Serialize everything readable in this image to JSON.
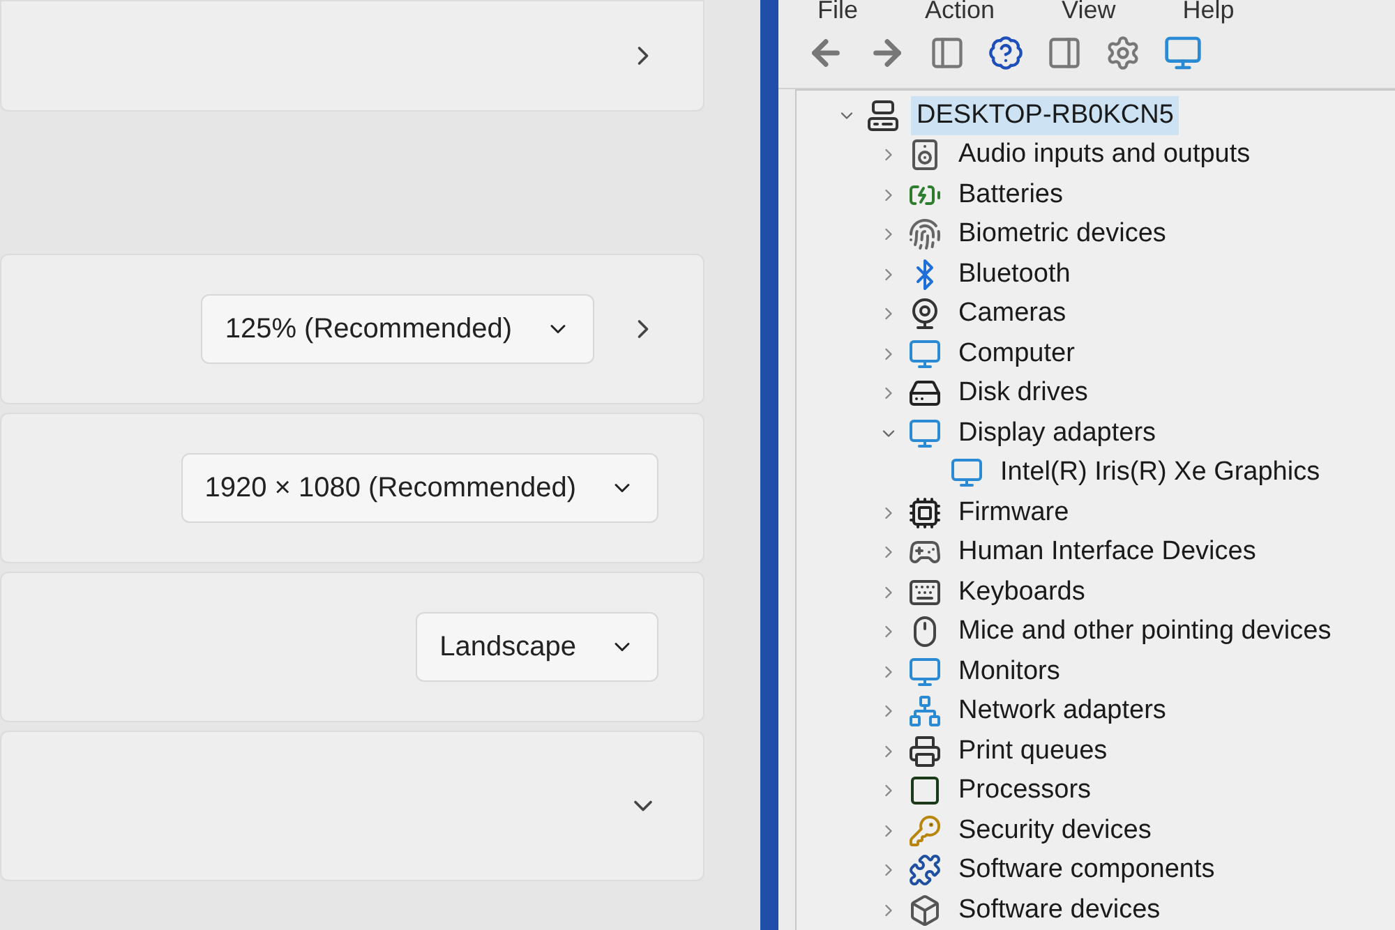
{
  "settings": {
    "cards": [
      {
        "kind": "link"
      },
      {
        "kind": "dropdown_link",
        "dropdown": "125% (Recommended)"
      },
      {
        "kind": "dropdown",
        "dropdown": "1920 × 1080 (Recommended)"
      },
      {
        "kind": "dropdown",
        "dropdown": "Landscape"
      },
      {
        "kind": "expander"
      }
    ]
  },
  "device_manager": {
    "menu": [
      "File",
      "Action",
      "View",
      "Help"
    ],
    "tree": {
      "label": "DESKTOP-RB0KCN5",
      "expanded": true,
      "selected": true,
      "children": [
        {
          "label": "Audio inputs and outputs",
          "expanded": false,
          "selected": false
        },
        {
          "label": "Batteries",
          "expanded": false,
          "selected": false
        },
        {
          "label": "Biometric devices",
          "expanded": false,
          "selected": false
        },
        {
          "label": "Bluetooth",
          "expanded": false,
          "selected": false
        },
        {
          "label": "Cameras",
          "expanded": false,
          "selected": false
        },
        {
          "label": "Computer",
          "expanded": false,
          "selected": false
        },
        {
          "label": "Disk drives",
          "expanded": false,
          "selected": false
        },
        {
          "label": "Display adapters",
          "expanded": true,
          "selected": false,
          "children": [
            {
              "label": "Intel(R) Iris(R) Xe Graphics",
              "selected": false
            }
          ]
        },
        {
          "label": "Firmware",
          "expanded": false,
          "selected": false
        },
        {
          "label": "Human Interface Devices",
          "expanded": false,
          "selected": false
        },
        {
          "label": "Keyboards",
          "expanded": false,
          "selected": false
        },
        {
          "label": "Mice and other pointing devices",
          "expanded": false,
          "selected": false
        },
        {
          "label": "Monitors",
          "expanded": false,
          "selected": false
        },
        {
          "label": "Network adapters",
          "expanded": false,
          "selected": false
        },
        {
          "label": "Print queues",
          "expanded": false,
          "selected": false
        },
        {
          "label": "Processors",
          "expanded": false,
          "selected": false
        },
        {
          "label": "Security devices",
          "expanded": false,
          "selected": false
        },
        {
          "label": "Software components",
          "expanded": false,
          "selected": false
        },
        {
          "label": "Software devices",
          "expanded": false,
          "selected": false
        }
      ]
    }
  }
}
